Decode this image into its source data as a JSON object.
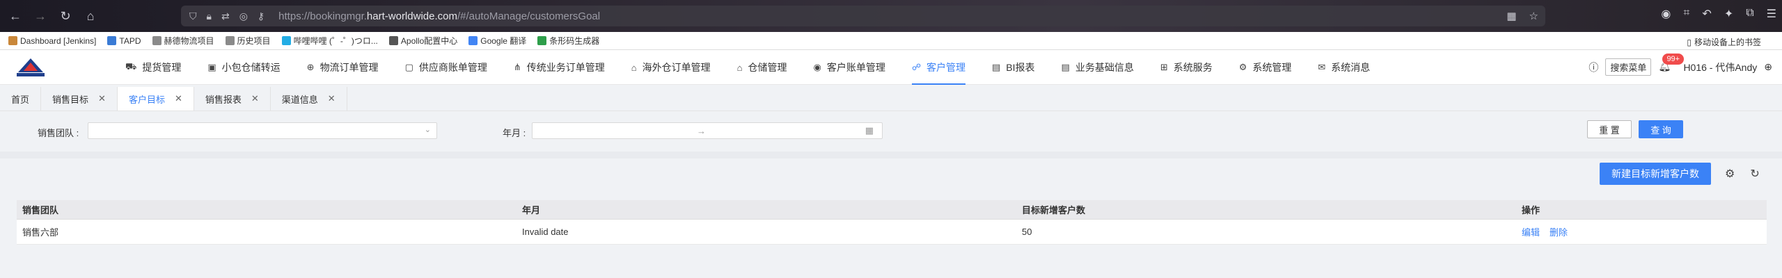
{
  "browser": {
    "url_prefix": "https://bookingmgr.",
    "url_domain": "hart-worldwide.com",
    "url_suffix": "/#/autoManage/customersGoal"
  },
  "bookmarks": {
    "items": [
      {
        "label": "Dashboard [Jenkins]",
        "color": "#c9873a"
      },
      {
        "label": "TAPD",
        "color": "#3a7bd5"
      },
      {
        "label": "赫德物流项目",
        "color": "#8a8a8a"
      },
      {
        "label": "历史项目",
        "color": "#8a8a8a"
      },
      {
        "label": "哔哩哔哩 (゜-゜)つロ...",
        "color": "#23ade5"
      },
      {
        "label": "Apollo配置中心",
        "color": "#555555"
      },
      {
        "label": "Google 翻译",
        "color": "#4285f4"
      },
      {
        "label": "条形码生成器",
        "color": "#2e9e4a"
      }
    ],
    "mobile": "移动设备上的书签"
  },
  "app": {
    "logo_text": "HART纵横",
    "menu": [
      {
        "label": "提货管理",
        "icon": "truck-icon",
        "glyph": "⛟"
      },
      {
        "label": "小包仓储转运",
        "icon": "package-icon",
        "glyph": "▣"
      },
      {
        "label": "物流订单管理",
        "icon": "globe-icon",
        "glyph": "⊕"
      },
      {
        "label": "供应商账单管理",
        "icon": "folder-icon",
        "glyph": "▢"
      },
      {
        "label": "传统业务订单管理",
        "icon": "sitemap-icon",
        "glyph": "⋔"
      },
      {
        "label": "海外仓订单管理",
        "icon": "home-icon",
        "glyph": "⌂"
      },
      {
        "label": "仓储管理",
        "icon": "warehouse-icon",
        "glyph": "⌂"
      },
      {
        "label": "客户账单管理",
        "icon": "coin-icon",
        "glyph": "◉"
      },
      {
        "label": "客户管理",
        "icon": "users-icon",
        "glyph": "☍",
        "active": true
      },
      {
        "label": "BI报表",
        "icon": "report-icon",
        "glyph": "▤"
      },
      {
        "label": "业务基础信息",
        "icon": "document-icon",
        "glyph": "▤"
      },
      {
        "label": "系统服务",
        "icon": "grid-icon",
        "glyph": "⊞"
      },
      {
        "label": "系统管理",
        "icon": "gear-icon",
        "glyph": "⚙"
      },
      {
        "label": "系统消息",
        "icon": "mail-icon",
        "glyph": "✉"
      }
    ],
    "search_menu": "搜索菜单",
    "badge": "99+",
    "user": "H016 - 代伟Andy"
  },
  "tabs": [
    {
      "label": "首页",
      "closable": false
    },
    {
      "label": "销售目标",
      "closable": true
    },
    {
      "label": "客户目标",
      "closable": true,
      "active": true
    },
    {
      "label": "销售报表",
      "closable": true
    },
    {
      "label": "渠道信息",
      "closable": true
    }
  ],
  "filter": {
    "team_label": "销售团队 :",
    "month_label": "年月 :",
    "range_sep": "→",
    "reset": "重 置",
    "query": "查 询"
  },
  "actions": {
    "new_button": "新建目标新增客户数"
  },
  "table": {
    "columns": [
      "销售团队",
      "年月",
      "目标新增客户数",
      "操作"
    ],
    "rows": [
      {
        "team": "销售六部",
        "month": "Invalid date",
        "target": "50",
        "edit": "编辑",
        "delete": "删除"
      }
    ]
  }
}
